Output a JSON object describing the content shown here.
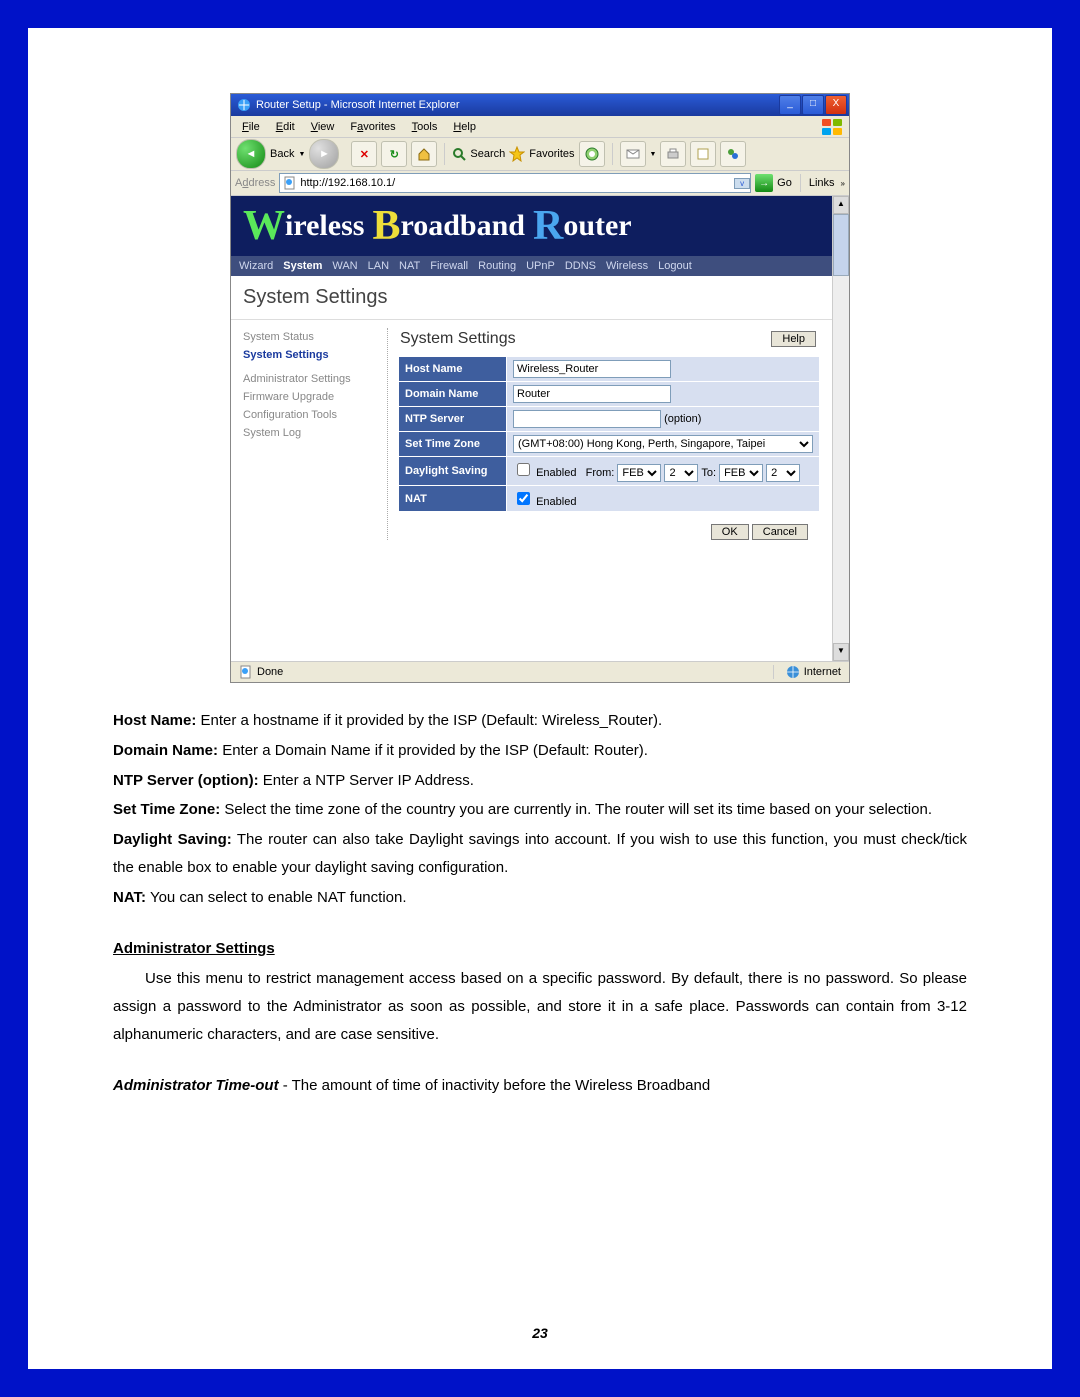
{
  "window": {
    "title": "Router Setup - Microsoft Internet Explorer",
    "minimize": "_",
    "maximize": "□",
    "close": "X"
  },
  "menubar": {
    "file": "File",
    "edit": "Edit",
    "view": "View",
    "favorites": "Favorites",
    "tools": "Tools",
    "help": "Help"
  },
  "toolbar": {
    "back": "Back",
    "search": "Search",
    "favorites": "Favorites"
  },
  "address": {
    "label": "Address",
    "value": "http://192.168.10.1/",
    "go": "Go",
    "links": "Links"
  },
  "banner": {
    "w": "W",
    "ireless": "ireless",
    "b": "B",
    "roadband": "roadband",
    "r": "R",
    "outer": "outer"
  },
  "nav": {
    "wizard": "Wizard",
    "system": "System",
    "wan": "WAN",
    "lan": "LAN",
    "nat": "NAT",
    "firewall": "Firewall",
    "routing": "Routing",
    "upnp": "UPnP",
    "ddns": "DDNS",
    "wireless": "Wireless",
    "logout": "Logout"
  },
  "page_title": "System Settings",
  "sidenav": {
    "i0": "System Status",
    "i1": "System Settings",
    "i2": "Administrator Settings",
    "i3": "Firmware Upgrade",
    "i4": "Configuration Tools",
    "i5": "System Log"
  },
  "panel": {
    "title": "System Settings",
    "help": "Help",
    "rows": {
      "hostname_label": "Host Name",
      "hostname_value": "Wireless_Router",
      "domain_label": "Domain Name",
      "domain_value": "Router",
      "ntp_label": "NTP Server",
      "ntp_value": "",
      "ntp_opt": "(option)",
      "tz_label": "Set Time Zone",
      "tz_value": "(GMT+08:00) Hong Kong, Perth, Singapore, Taipei",
      "ds_label": "Daylight Saving",
      "ds_enabled": "Enabled",
      "ds_from": "From:",
      "ds_to": "To:",
      "ds_month1": "FEB",
      "ds_day1": "2",
      "ds_month2": "FEB",
      "ds_day2": "2",
      "nat_label": "NAT",
      "nat_enabled": "Enabled"
    },
    "ok": "OK",
    "cancel": "Cancel"
  },
  "statusbar": {
    "done": "Done",
    "zone": "Internet"
  },
  "doc": {
    "hostname_b": "Host Name:",
    "hostname_t": " Enter a hostname if it provided by the ISP (Default: Wireless_Router).",
    "domain_b": "Domain Name:",
    "domain_t": " Enter a Domain Name if it provided by the ISP (Default: Router).",
    "ntp_b": "NTP Server (option):",
    "ntp_t": " Enter a NTP Server IP Address.",
    "tz_b": "Set Time Zone:",
    "tz_t": " Select the time zone of the country you are currently in. The router will set its time based on your selection.",
    "ds_b": "Daylight Saving:",
    "ds_t": " The router can also take Daylight savings into account. If you wish to use this function, you must check/tick the enable box to enable your daylight saving configuration.",
    "nat_b": "NAT:",
    "nat_t": " You can select to enable NAT function.",
    "admin_head": "Administrator Settings",
    "admin_p": "Use this menu to restrict management access based on a specific password. By default, there is no password. So please assign a password to the Administrator as soon as possible, and store it in a safe place. Passwords can contain from 3-12 alphanumeric characters, and are case sensitive.",
    "timeout_b": "Administrator Time-out",
    "timeout_t": " - The amount of time of inactivity before the Wireless Broadband"
  },
  "page_number": "23"
}
